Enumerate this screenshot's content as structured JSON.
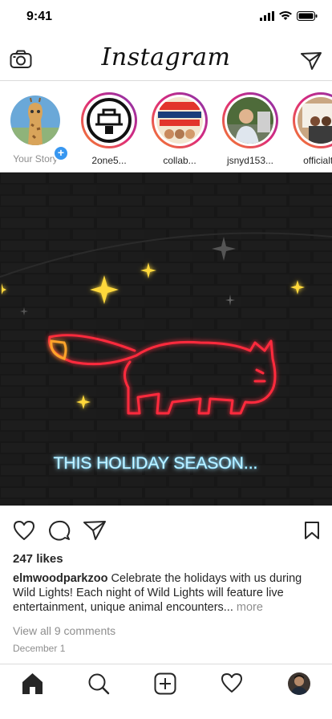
{
  "status": {
    "time": "9:41"
  },
  "header": {
    "logo": "Instagram"
  },
  "stories": [
    {
      "name": "Your Story",
      "own": true
    },
    {
      "name": "2one5..."
    },
    {
      "name": "collab..."
    },
    {
      "name": "jsnyd153..."
    },
    {
      "name": "officialto"
    }
  ],
  "post": {
    "banner_text": "THIS HOLIDAY SEASON..."
  },
  "likes": "247 likes",
  "caption": {
    "username": "elmwoodparkzoo",
    "text": "Celebrate the holidays with us during Wild Lights! Each night of Wild Lights will feature live entertainment, unique animal encounters... ",
    "more": "more"
  },
  "comments": "View all 9 comments",
  "date": "December 1",
  "colors": {
    "accent_blue": "#3897f0",
    "neon_red": "#ff2a3c",
    "neon_yellow": "#ffd83a"
  }
}
